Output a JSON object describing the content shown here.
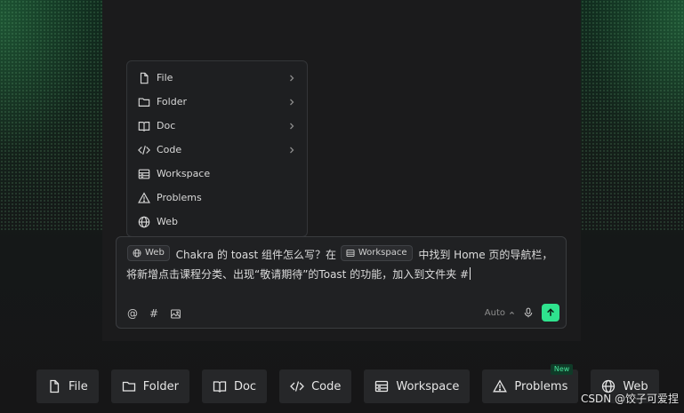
{
  "menu": {
    "items": [
      {
        "label": "File",
        "icon": "file-icon",
        "has_submenu": true
      },
      {
        "label": "Folder",
        "icon": "folder-icon",
        "has_submenu": true
      },
      {
        "label": "Doc",
        "icon": "book-icon",
        "has_submenu": true
      },
      {
        "label": "Code",
        "icon": "code-icon",
        "has_submenu": true
      },
      {
        "label": "Workspace",
        "icon": "workspace-icon",
        "has_submenu": false
      },
      {
        "label": "Problems",
        "icon": "warning-icon",
        "has_submenu": false
      },
      {
        "label": "Web",
        "icon": "globe-icon",
        "has_submenu": false
      }
    ]
  },
  "composer": {
    "chip_web": "Web",
    "text_1": "Chakra 的 toast 组件怎么写？在",
    "chip_workspace": "Workspace",
    "text_2": "中找到 Home 页的导航栏，",
    "text_3": "将新增点击课程分类、出现“敬请期待”的Toast 的功能，加入到文件夹 #",
    "tools": [
      "at-icon",
      "hash-icon",
      "image-icon"
    ],
    "tool_at": "@",
    "tool_hash": "#",
    "model_label": "Auto",
    "send_color": "#2fe38e"
  },
  "bottom_bar": {
    "items": [
      {
        "label": "File",
        "icon": "file-icon"
      },
      {
        "label": "Folder",
        "icon": "folder-icon"
      },
      {
        "label": "Doc",
        "icon": "book-icon"
      },
      {
        "label": "Code",
        "icon": "code-icon"
      },
      {
        "label": "Workspace",
        "icon": "workspace-icon"
      },
      {
        "label": "Problems",
        "icon": "warning-icon",
        "badge": "New"
      },
      {
        "label": "Web",
        "icon": "globe-icon"
      }
    ]
  },
  "watermark": "CSDN @饺子可爱捏",
  "colors": {
    "accent": "#2fe38e",
    "badge_text": "#47e39a",
    "panel": "#1b1b1c"
  }
}
